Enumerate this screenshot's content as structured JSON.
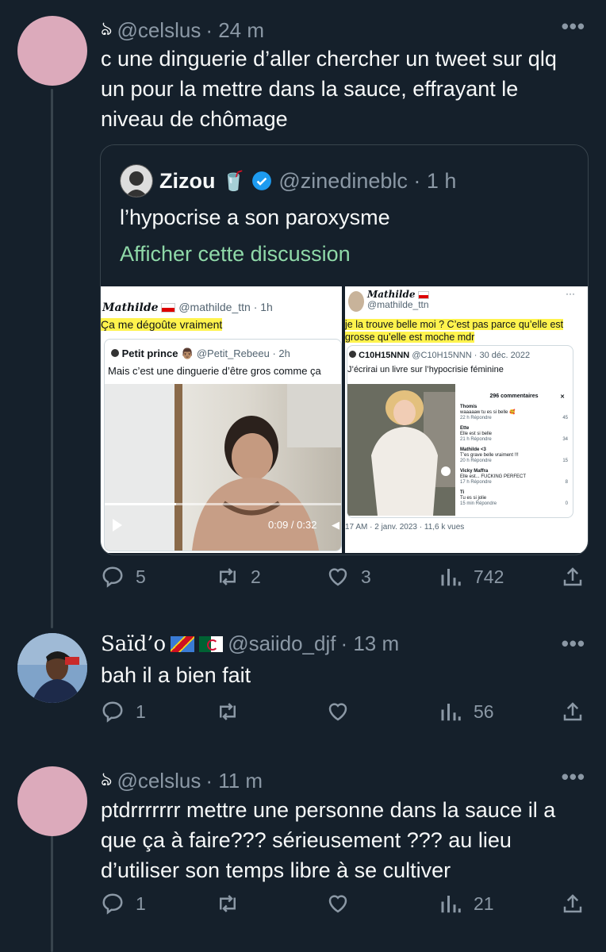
{
  "tweets": [
    {
      "handle": "@celslus",
      "time": "· 24 m",
      "text": "c une dinguerie d’aller chercher un tweet sur qlq un pour la mettre dans la sauce, effrayant le niveau de chômage",
      "replies": "5",
      "retweets": "2",
      "likes": "3",
      "views": "742",
      "more_label": "•••",
      "quote": {
        "name": "Zizou",
        "emoji": "🥤",
        "handle": "@zinedineblc · 1 h",
        "text": "l’hypocrise a son paroxysme",
        "link": "Afficher cette discussion",
        "left_card": {
          "author": "Mathilde",
          "author_handle": "@mathilde_ttn · 1h",
          "text": "Ça me dégoûte vraiment",
          "inner_name": "Petit prince",
          "inner_handle": "@Petit_Rebeeu · 2h",
          "inner_text": "Mais c’est une dinguerie d’être gros comme ça",
          "video_time": "0:09 / 0:32"
        },
        "right_card": {
          "author": "Mathilde",
          "author_handle": "@mathilde_ttn",
          "text": "je la trouve belle moi ? C’est pas parce qu’elle est grosse qu’elle est moche mdr",
          "inner_name": "C10H15NNN",
          "inner_handle": "@C10H15NNN · 30 déc. 2022",
          "inner_text": "J’écrirai un livre sur l’hypocrisie féminine",
          "comments_title": "296 commentaires",
          "comments": [
            {
              "user": "Thomis",
              "text": "waaaaaw tu es si belle 🥰",
              "meta": "22 h Répondre",
              "likes": "45"
            },
            {
              "user": "Ette",
              "text": "Elle est si belle",
              "meta": "21 h Répondre",
              "likes": "34"
            },
            {
              "user": "Mathilde <3",
              "text": "T’es grave belle vraiment !!!",
              "meta": "20 h Répondre",
              "likes": "15"
            },
            {
              "user": "Vicky Maffra",
              "text": "Elle est... FUCKING PERFECT",
              "meta": "17 h Répondre",
              "likes": "8"
            },
            {
              "user": "Ti",
              "text": "Tu es si jolie",
              "meta": "15 min Répondre",
              "likes": "0"
            }
          ],
          "footer": "17 AM · 2 janv. 2023 · 11,6 k vues"
        }
      }
    },
    {
      "name": "Saïd’o",
      "handle": "@saiido_djf",
      "time": "· 13 m",
      "text": "bah il a bien fait",
      "replies": "1",
      "views": "56",
      "more_label": "•••"
    },
    {
      "handle": "@celslus",
      "time": "· 11 m",
      "text": "ptdrrrrrrr mettre une personne dans la sauce il a que ça à faire??? sérieusement ??? au lieu d’utiliser son temps libre à se cultiver",
      "replies": "1",
      "views": "21",
      "more_label": "•••"
    }
  ],
  "colors": {
    "background": "#15202b",
    "muted": "#8b98a5",
    "link": "#8fd9a8",
    "verified": "#1d9bf0"
  }
}
